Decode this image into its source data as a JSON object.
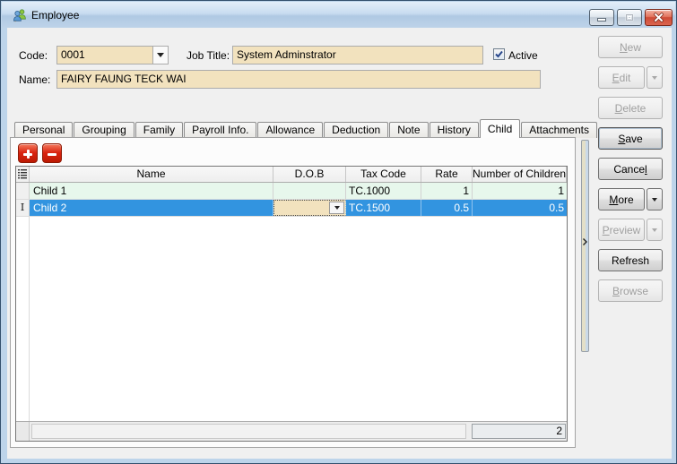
{
  "window": {
    "title": "Employee",
    "icon": "employees-icon",
    "controls": [
      "minimize",
      "maximize-restore",
      "close"
    ]
  },
  "form": {
    "code": {
      "label": "Code:",
      "value": "0001"
    },
    "job_title": {
      "label": "Job Title:",
      "value": "System Adminstrator"
    },
    "active": {
      "label": "Active",
      "checked": true
    },
    "name": {
      "label": "Name:",
      "value": "FAIRY FAUNG TECK WAI"
    }
  },
  "tabs": [
    {
      "label": "Personal",
      "active": false
    },
    {
      "label": "Grouping",
      "active": false
    },
    {
      "label": "Family",
      "active": false
    },
    {
      "label": "Payroll Info.",
      "active": false
    },
    {
      "label": "Allowance",
      "active": false
    },
    {
      "label": "Deduction",
      "active": false
    },
    {
      "label": "Note",
      "active": false
    },
    {
      "label": "History",
      "active": false
    },
    {
      "label": "Child",
      "active": true
    },
    {
      "label": "Attachments",
      "active": false
    }
  ],
  "toolbar": {
    "add_icon": "plus-icon",
    "remove_icon": "minus-icon"
  },
  "grid": {
    "columns": [
      "Name",
      "D.O.B",
      "Tax Code",
      "Rate",
      "Number of Children"
    ],
    "rows": [
      {
        "name": "Child 1",
        "dob": "",
        "tax_code": "TC.1000",
        "rate": "1",
        "number_of_children": "1",
        "selected": false,
        "dob_editing": false
      },
      {
        "name": "Child 2",
        "dob": "",
        "tax_code": "TC.1500",
        "rate": "0.5",
        "number_of_children": "0.5",
        "selected": true,
        "dob_editing": true
      }
    ],
    "summary_count": "2"
  },
  "side_buttons": [
    {
      "label": "&New",
      "enabled": false,
      "split": false,
      "default": false
    },
    {
      "label": "&Edit",
      "enabled": false,
      "split": true,
      "default": false
    },
    {
      "label": "&Delete",
      "enabled": false,
      "split": false,
      "default": false
    },
    {
      "label": "&Save",
      "enabled": true,
      "split": false,
      "default": true
    },
    {
      "label": "Cance&l",
      "enabled": true,
      "split": false,
      "default": false
    },
    {
      "label": "&More",
      "enabled": true,
      "split": true,
      "default": false
    },
    {
      "label": "&Preview",
      "enabled": false,
      "split": true,
      "default": false
    },
    {
      "label": "Refresh",
      "enabled": true,
      "split": false,
      "default": false
    },
    {
      "label": "&Browse",
      "enabled": false,
      "split": false,
      "default": false
    }
  ],
  "colors": {
    "selection": "#3294E0",
    "row_alt": "#E7F7EC",
    "field_bg": "#F2E2BE",
    "danger_button": "#D9230F",
    "titlebar": "#BDD4EA"
  }
}
